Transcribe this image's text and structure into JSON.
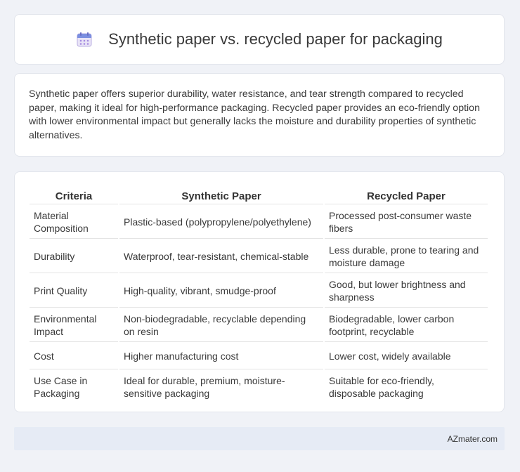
{
  "header": {
    "title": "Synthetic paper vs. recycled paper for packaging"
  },
  "summary": {
    "text": "Synthetic paper offers superior durability, water resistance, and tear strength compared to recycled paper, making it ideal for high-performance packaging. Recycled paper provides an eco-friendly option with lower environmental impact but generally lacks the moisture and durability properties of synthetic alternatives."
  },
  "table": {
    "headers": [
      "Criteria",
      "Synthetic Paper",
      "Recycled Paper"
    ],
    "rows": [
      [
        "Material Composition",
        "Plastic-based (polypropylene/polyethylene)",
        "Processed post-consumer waste fibers"
      ],
      [
        "Durability",
        "Waterproof, tear-resistant, chemical-stable",
        "Less durable, prone to tearing and moisture damage"
      ],
      [
        "Print Quality",
        "High-quality, vibrant, smudge-proof",
        "Good, but lower brightness and sharpness"
      ],
      [
        "Environmental Impact",
        "Non-biodegradable, recyclable depending on resin",
        "Biodegradable, lower carbon footprint, recyclable"
      ],
      [
        "Cost",
        "Higher manufacturing cost",
        "Lower cost, widely available"
      ],
      [
        "Use Case in Packaging",
        "Ideal for durable, premium, moisture-sensitive packaging",
        "Suitable for eco-friendly, disposable packaging"
      ]
    ]
  },
  "footer": {
    "text": "AZmater.com"
  },
  "icons": {
    "title_icon": "calendar-icon"
  }
}
